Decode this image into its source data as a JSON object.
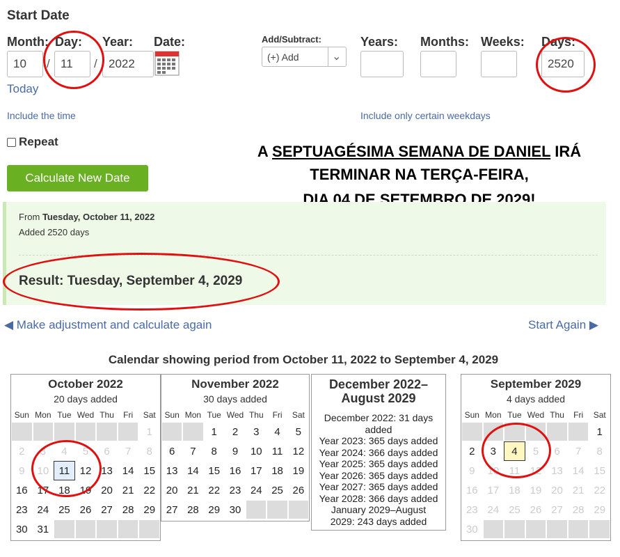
{
  "start_date": {
    "title": "Start Date",
    "labels": {
      "month": "Month:",
      "day": "Day:",
      "year": "Year:",
      "date": "Date:"
    },
    "values": {
      "month": "10",
      "day": "11",
      "year": "2022"
    },
    "separator": "/",
    "today_link": "Today",
    "include_time_link": "Include the time",
    "repeat_label": "Repeat"
  },
  "add_subtract": {
    "label": "Add/Subtract:",
    "selected": "(+) Add",
    "labels": {
      "years": "Years:",
      "months": "Months:",
      "weeks": "Weeks:",
      "days": "Days:"
    },
    "values": {
      "years": "",
      "months": "",
      "weeks": "",
      "days": "2520"
    },
    "weekdays_link": "Include only certain weekdays"
  },
  "calculate_button": "Calculate New Date",
  "overlay": {
    "line1_prefix": "A ",
    "line1_underlined": "SEPTUAGÉSIMA SEMANA DE DANIEL",
    "line1_suffix": " IRÁ",
    "line2": "TERMINAR NA TERÇA-FEIRA,",
    "line3": "DIA 04 DE SETEMBRO DE 2029!"
  },
  "result": {
    "from_prefix": "From ",
    "from_date": "Tuesday, October 11, 2022",
    "added": "Added 2520 days",
    "result": "Result: Tuesday, September 4, 2029"
  },
  "nav": {
    "adjust": "◀ Make adjustment and calculate again",
    "start_again": "Start Again ▶"
  },
  "calendar_heading": "Calendar showing period from October 11, 2022 to September 4, 2029",
  "weekdays": [
    "Sun",
    "Mon",
    "Tue",
    "Wed",
    "Thu",
    "Fri",
    "Sat"
  ],
  "calendars": {
    "oct": {
      "title": "October 2022",
      "sub": "20 days added",
      "cells": [
        [
          "",
          "",
          "",
          "",
          "",
          "",
          "1f"
        ],
        [
          "2f",
          "3f",
          "4f",
          "5f",
          "6f",
          "7f",
          "8f"
        ],
        [
          "9f",
          "10f",
          "11b",
          "12",
          "13",
          "14",
          "15"
        ],
        [
          "16",
          "17",
          "18",
          "19",
          "20",
          "21",
          "22"
        ],
        [
          "23",
          "24",
          "25",
          "26",
          "27",
          "28",
          "29"
        ],
        [
          "30",
          "31",
          "",
          "",
          "",
          "",
          ""
        ]
      ]
    },
    "nov": {
      "title": "November 2022",
      "sub": "30 days added",
      "cells": [
        [
          "",
          "",
          "1",
          "2",
          "3",
          "4",
          "5"
        ],
        [
          "6",
          "7",
          "8",
          "9",
          "10",
          "11",
          "12"
        ],
        [
          "13",
          "14",
          "15",
          "16",
          "17",
          "18",
          "19"
        ],
        [
          "20",
          "21",
          "22",
          "23",
          "24",
          "25",
          "26"
        ],
        [
          "27",
          "28",
          "29",
          "30",
          "",
          "",
          ""
        ]
      ]
    },
    "mid": {
      "title_line1": "December 2022–",
      "title_line2": "August 2029",
      "lines": [
        "December 2022: 31 days",
        "added",
        "Year 2023: 365 days added",
        "Year 2024: 366 days added",
        "Year 2025: 365 days added",
        "Year 2026: 365 days added",
        "Year 2027: 365 days added",
        "Year 2028: 366 days added",
        "January 2029–August",
        "2029: 243 days added"
      ]
    },
    "sep": {
      "title": "September 2029",
      "sub": "4 days added",
      "cells": [
        [
          "",
          "",
          "",
          "",
          "",
          "",
          "1"
        ],
        [
          "2",
          "3",
          "4y",
          "5f",
          "6f",
          "7f",
          "8f"
        ],
        [
          "9f",
          "10f",
          "11f",
          "12f",
          "13f",
          "14f",
          "15f"
        ],
        [
          "16f",
          "17f",
          "18f",
          "19f",
          "20f",
          "21f",
          "22f"
        ],
        [
          "23f",
          "24f",
          "25f",
          "26f",
          "27f",
          "28f",
          "29f"
        ],
        [
          "30f",
          "",
          "",
          "",
          "",
          "",
          ""
        ]
      ]
    }
  },
  "colors": {
    "button": "#6ab023",
    "link": "#4a6aa5",
    "result_bg": "#eef9e8",
    "annotation_red": "#e01010"
  }
}
